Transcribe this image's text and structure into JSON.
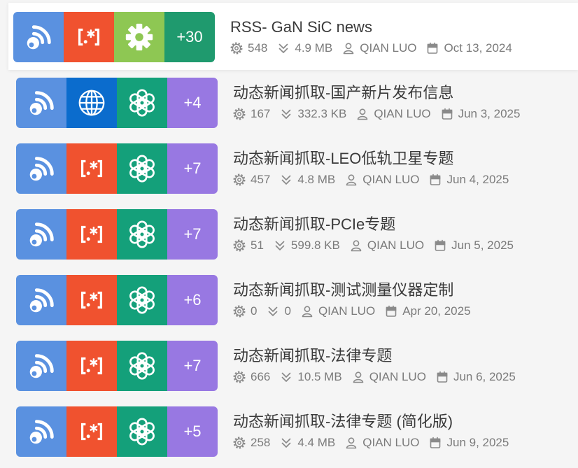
{
  "node_colors": {
    "rss-icon": "#5a91e0",
    "regex-icon": "#f0522f",
    "gear-icon": "#8ec753",
    "globe-icon": "#0b6ccd",
    "openai-icon": "#14a07a"
  },
  "meta_icons": {
    "count": "gear-outline-icon",
    "size": "double-chevron-down-icon",
    "owner": "user-icon",
    "date": "calendar-icon"
  },
  "workflows": [
    {
      "title": "RSS- GaN SiC news",
      "count": "548",
      "size": "4.9 MB",
      "owner": "QIAN LUO",
      "date": "Oct 13, 2024",
      "nodes": [
        "rss-icon",
        "regex-icon",
        "gear-icon"
      ],
      "more": "+30",
      "more_color": "#1f9a6e",
      "highlighted": true
    },
    {
      "title": "动态新闻抓取-国产新片发布信息",
      "count": "167",
      "size": "332.3 KB",
      "owner": "QIAN LUO",
      "date": "Jun 3, 2025",
      "nodes": [
        "rss-icon",
        "globe-icon",
        "openai-icon"
      ],
      "more": "+4",
      "more_color": "#9878e2",
      "highlighted": false
    },
    {
      "title": "动态新闻抓取-LEO低轨卫星专题",
      "count": "457",
      "size": "4.8 MB",
      "owner": "QIAN LUO",
      "date": "Jun 4, 2025",
      "nodes": [
        "rss-icon",
        "regex-icon",
        "openai-icon"
      ],
      "more": "+7",
      "more_color": "#9878e2",
      "highlighted": false
    },
    {
      "title": "动态新闻抓取-PCIe专题",
      "count": "51",
      "size": "599.8 KB",
      "owner": "QIAN LUO",
      "date": "Jun 5, 2025",
      "nodes": [
        "rss-icon",
        "regex-icon",
        "openai-icon"
      ],
      "more": "+7",
      "more_color": "#9878e2",
      "highlighted": false
    },
    {
      "title": "动态新闻抓取-测试测量仪器定制",
      "count": "0",
      "size": "0",
      "owner": "QIAN LUO",
      "date": "Apr 20, 2025",
      "nodes": [
        "rss-icon",
        "regex-icon",
        "openai-icon"
      ],
      "more": "+6",
      "more_color": "#9878e2",
      "highlighted": false
    },
    {
      "title": "动态新闻抓取-法律专题",
      "count": "666",
      "size": "10.5 MB",
      "owner": "QIAN LUO",
      "date": "Jun 6, 2025",
      "nodes": [
        "rss-icon",
        "regex-icon",
        "openai-icon"
      ],
      "more": "+7",
      "more_color": "#9878e2",
      "highlighted": false
    },
    {
      "title": "动态新闻抓取-法律专题 (简化版)",
      "count": "258",
      "size": "4.4 MB",
      "owner": "QIAN LUO",
      "date": "Jun 9, 2025",
      "nodes": [
        "rss-icon",
        "regex-icon",
        "openai-icon"
      ],
      "more": "+5",
      "more_color": "#9878e2",
      "highlighted": false
    }
  ]
}
